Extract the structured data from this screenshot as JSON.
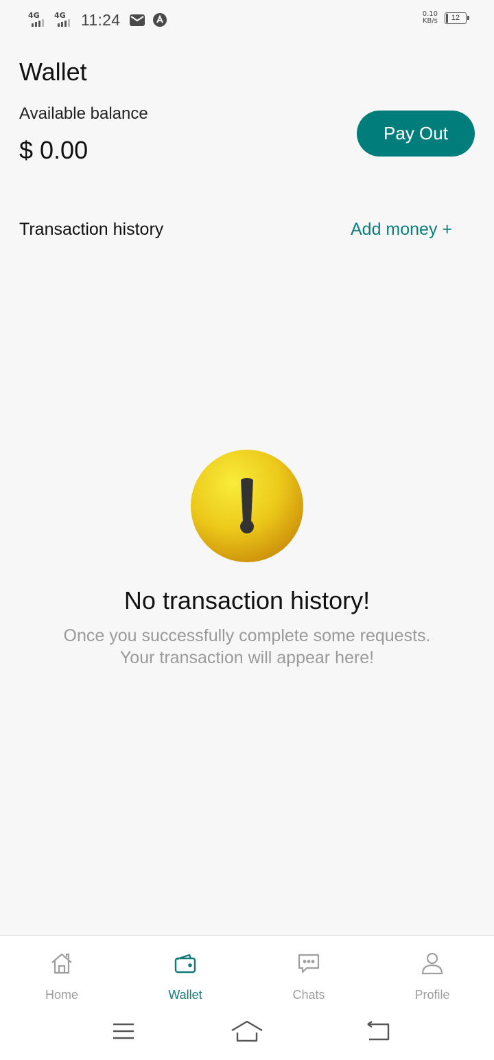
{
  "status_bar": {
    "network_1": "4G",
    "network_2": "4G",
    "time": "11:24",
    "speed_value": "0.10",
    "speed_unit": "KB/s",
    "battery": "12",
    "icons": [
      "signal-icon",
      "signal-icon",
      "mail-icon",
      "app-notification-icon",
      "battery-icon"
    ]
  },
  "header": {
    "title": "Wallet",
    "balance_label": "Available balance",
    "balance_value": "$ 0.00",
    "payout_label": "Pay Out"
  },
  "transactions": {
    "title": "Transaction history",
    "add_money_label": "Add money +"
  },
  "empty_state": {
    "icon": "warning-exclamation-icon",
    "title": "No transaction history!",
    "line1": "Once you successfully complete some requests.",
    "line2": "Your transaction will appear here!"
  },
  "bottom_nav": {
    "items": [
      {
        "label": "Home",
        "icon": "home-icon",
        "active": false
      },
      {
        "label": "Wallet",
        "icon": "wallet-icon",
        "active": true
      },
      {
        "label": "Chats",
        "icon": "chat-icon",
        "active": false
      },
      {
        "label": "Profile",
        "icon": "profile-icon",
        "active": false
      }
    ]
  },
  "system_nav": {
    "icons": [
      "menu-icon",
      "home-gesture-icon",
      "back-icon"
    ]
  },
  "colors": {
    "accent": "#017e7c",
    "accent_text": "#0b7f7c",
    "background": "#f7f7f7",
    "muted_text": "#9a9a9a",
    "inactive_nav": "#9e9e9e",
    "warning_yellow": "#f0d21f"
  }
}
